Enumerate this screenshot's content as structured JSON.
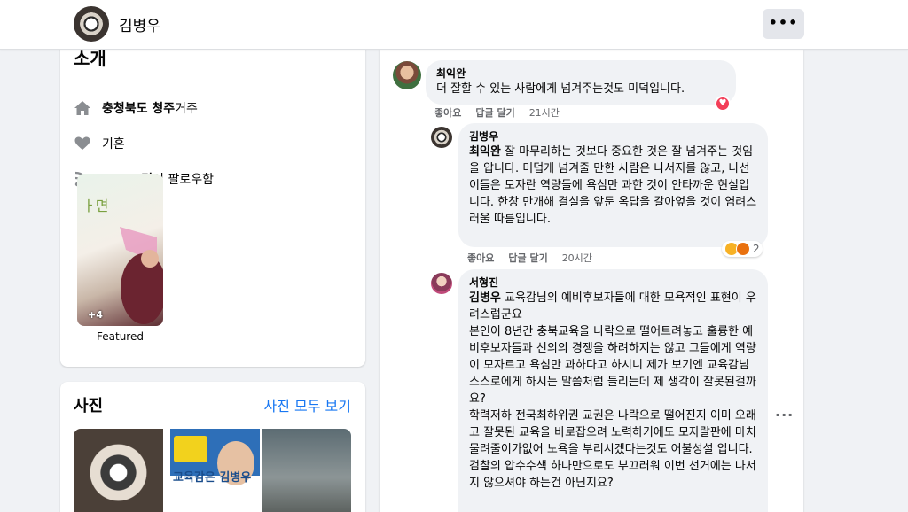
{
  "header": {
    "profile_name": "김병우",
    "more_label": "•••"
  },
  "intro": {
    "heading": "소개",
    "location_bold": "충청북도 청주",
    "location_suffix": " 거주",
    "relationship": "기혼",
    "followers_bold": "3,304명",
    "followers_suffix": "이 팔로우함",
    "featured_label": "Featured",
    "featured_count": "+4"
  },
  "photos": {
    "title": "사진",
    "see_all": "사진 모두 보기",
    "photo2_text": "교육감은 김병우"
  },
  "comments": [
    {
      "author": "최익완",
      "text": "더 잘할 수 있는 사람에게 넘겨주는것도 미덕입니다.",
      "like": "좋아요",
      "reply": "답글 달기",
      "time": "21시간",
      "reaction": "heart"
    },
    {
      "author": "김병우",
      "mention": "최익완",
      "text": " 잘 마무리하는 것보다 중요한 것은 잘 넘겨주는 것임을 압니다. 미덥게 넘겨줄 만한 사람은 나서지를 않고, 나선 이들은 모자란 역량들에 욕심만 과한 것이 안타까운 현실입니다. 한창 만개해 결실을 앞둔 옥답을 갈아엎을 것이 염려스러울 따름입니다.",
      "like": "좋아요",
      "reply": "답글 달기",
      "time": "20시간",
      "reaction_count": "2"
    },
    {
      "author": "서형진",
      "mention": "김병우",
      "lines": [
        " 교육감님의 예비후보자들에 대한 모욕적인 표현이 우려스럽군요",
        "본인이 8년간 충북교육을 나락으로 떨어트려놓고 훌륭한 예비후보자들과 선의의 경쟁을 하려하지는 않고 그들에게 역량이 모자르고 욕심만 과하다고 하시니 제가 보기엔 교육감님 스스로에게 하시는 말씀처럼 들리는데 제 생각이 잘못된걸까요?",
        "학력저하 전국최하위권 교권은 나락으로 떨어진지 이미 오래고 잘못된 교육을 바로잡으려 노력하기에도 모자랄판에 마치 물려줄이가없어 노욕을 부리시겠다는것도 어불성설 입니다.",
        "검찰의 압수수색 하나만으로도 부끄러워 이번 선거에는 나서지 않으셔야 하는건 아닌지요?"
      ]
    }
  ],
  "colors": {
    "link": "#1877f2",
    "bubble": "#f0f2f5",
    "page_bg": "#f0f2f5",
    "heart": "#f33e58"
  }
}
